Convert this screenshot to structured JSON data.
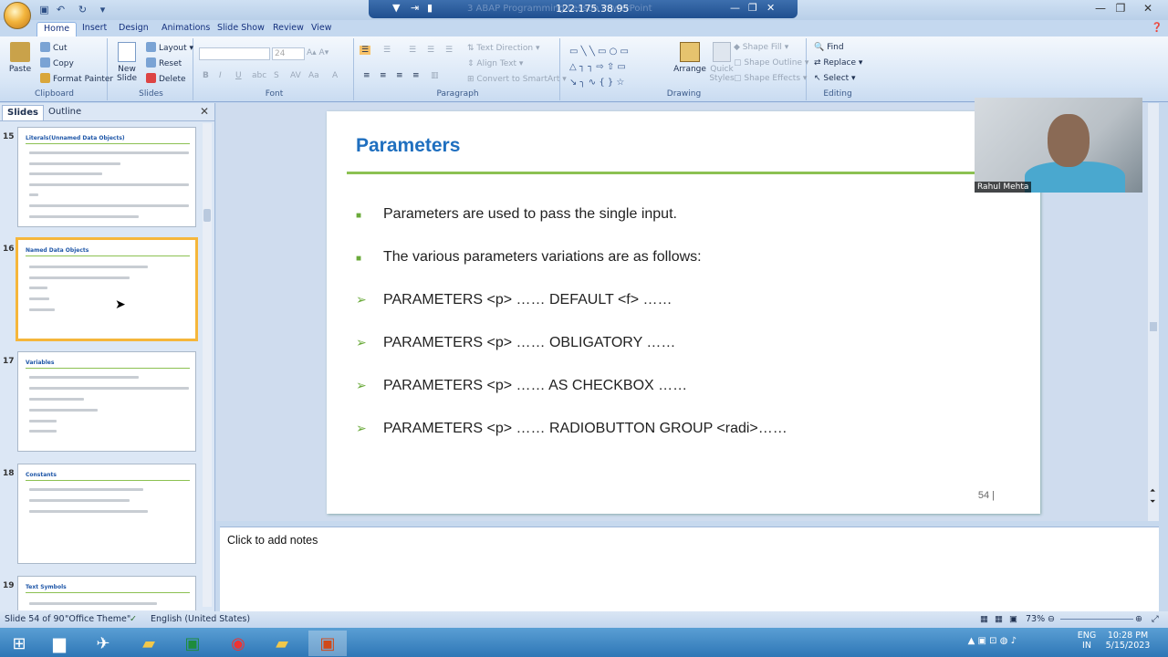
{
  "titlebar": {
    "ip": "122.175.38.95",
    "ghost_title": "3 ABAP Programming Lesson PowerPoint"
  },
  "ribbon_tabs": [
    "Home",
    "Insert",
    "Design",
    "Animations",
    "Slide Show",
    "Review",
    "View"
  ],
  "ribbon": {
    "clipboard": {
      "paste": "Paste",
      "cut": "Cut",
      "copy": "Copy",
      "format_painter": "Format Painter",
      "label": "Clipboard"
    },
    "slides": {
      "new_slide": "New Slide",
      "layout": "Layout",
      "reset": "Reset",
      "delete": "Delete",
      "label": "Slides"
    },
    "font": {
      "size": "24",
      "label": "Font"
    },
    "paragraph": {
      "text_direction": "Text Direction",
      "align_text": "Align Text",
      "smartart": "Convert to SmartArt",
      "label": "Paragraph"
    },
    "drawing": {
      "arrange": "Arrange",
      "quick_styles": "Quick Styles",
      "shape_fill": "Shape Fill",
      "shape_outline": "Shape Outline",
      "shape_effects": "Shape Effects",
      "label": "Drawing"
    },
    "editing": {
      "find": "Find",
      "replace": "Replace",
      "select": "Select",
      "label": "Editing"
    }
  },
  "left_panel": {
    "tab_slides": "Slides",
    "tab_outline": "Outline",
    "thumbnails": [
      {
        "num": "15",
        "title": "Literals(Unnamed Data Objects)"
      },
      {
        "num": "16",
        "title": "Named Data Objects"
      },
      {
        "num": "17",
        "title": "Variables"
      },
      {
        "num": "18",
        "title": "Constants"
      },
      {
        "num": "19",
        "title": "Text Symbols"
      }
    ]
  },
  "slide": {
    "title": "Parameters",
    "bullets": [
      "Parameters are used to pass the single input.",
      "The various parameters variations are as follows:"
    ],
    "arrows": [
      "PARAMETERS <p> …… DEFAULT <f> ……",
      "PARAMETERS <p> …… OBLIGATORY ……",
      "PARAMETERS <p> …… AS CHECKBOX ……",
      "PARAMETERS <p> …… RADIOBUTTON GROUP <radi>……"
    ],
    "page_number": "54 |"
  },
  "webcam": {
    "name": "Rahul Mehta"
  },
  "notes": {
    "placeholder": "Click to add notes"
  },
  "status": {
    "slide": "Slide 54 of 90",
    "theme": "\"Office Theme\"",
    "language": "English (United States)",
    "zoom": "73%"
  },
  "tray": {
    "lang": "ENG",
    "region": "IN",
    "time": "10:28 PM",
    "date": "5/15/2023"
  }
}
